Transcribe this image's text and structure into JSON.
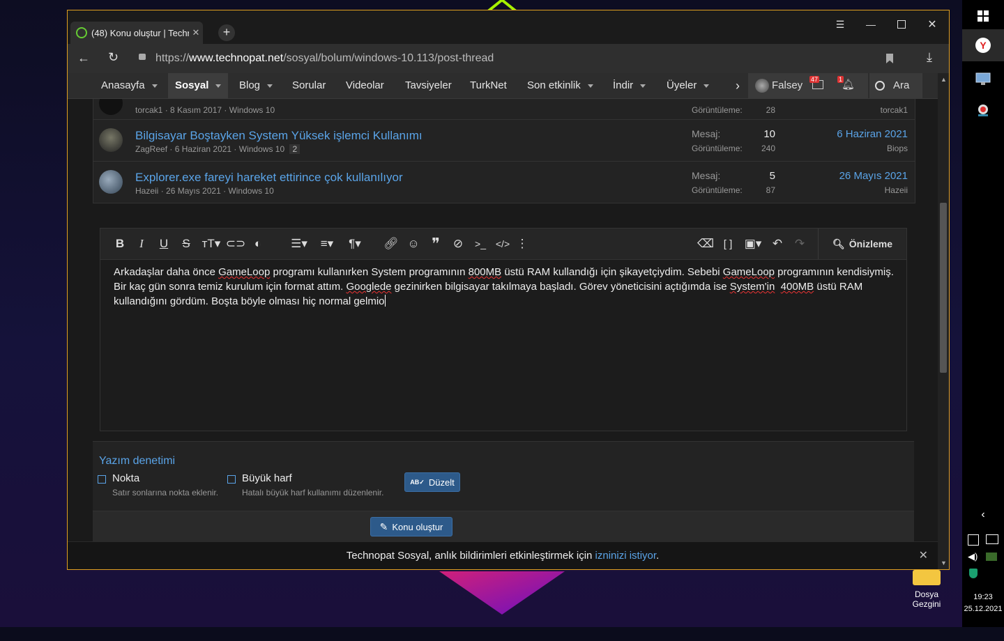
{
  "browser": {
    "tab_title": "(48) Konu oluştur | Techn",
    "url_prefix": "https://",
    "url_domain": "www.technopat.net",
    "url_path": "/sosyal/bolum/windows-10.113/post-thread"
  },
  "nav": {
    "items": [
      "Anasayfa",
      "Sosyal",
      "Blog",
      "Sorular",
      "Videolar",
      "Tavsiyeler",
      "TurkNet",
      "Son etkinlik",
      "İndir",
      "Üyeler"
    ],
    "user": "Falsey",
    "messages_badge": "47",
    "alerts_badge": "1",
    "search": "Ara"
  },
  "threads": [
    {
      "meta_user": "torcak1",
      "meta_date": "8 Kasım 2017",
      "meta_forum": "Windows 10",
      "views_label": "Görüntüleme:",
      "views": "28",
      "last_user": "torcak1"
    },
    {
      "title": "Bilgisayar Boştayken System Yüksek işlemci Kullanımı",
      "meta_user": "ZagReef",
      "meta_date": "6 Haziran 2021",
      "meta_forum": "Windows 10",
      "pages": "2",
      "msg_label": "Mesaj:",
      "messages": "10",
      "views_label": "Görüntüleme:",
      "views": "240",
      "last_date": "6 Haziran 2021",
      "last_user": "Biops"
    },
    {
      "title": "Explorer.exe fareyi hareket ettirince çok kullanılıyor",
      "meta_user": "Hazeii",
      "meta_date": "26 Mayıs 2021",
      "meta_forum": "Windows 10",
      "msg_label": "Mesaj:",
      "messages": "5",
      "views_label": "Görüntüleme:",
      "views": "87",
      "last_date": "26 Mayıs 2021",
      "last_user": "Hazeii"
    }
  ],
  "editor": {
    "preview": "Önizleme",
    "t1": "Arkadaşlar daha önce ",
    "w1": "GameLoop",
    "t2": " programı kullanırken System programının ",
    "w2": "800MB",
    "t3": " üstü RAM kullandığı için şikayetçiydim. Sebebi ",
    "w3": "GameLoop",
    "t4": " programının kendisiymiş.",
    "t5": "Bir kaç gün sonra temiz kurulum için format attım. ",
    "w4": "Googlede",
    "t6": " gezinirken bilgisayar takılmaya başladı. Görev yöneticisini açtığımda ise ",
    "w5": "System'in",
    "t7": "  ",
    "w6": "400MB",
    "t8": " üstü RAM",
    "t9": "kullandığını gördüm. Boşta böyle olması hiç normal gelmio"
  },
  "spellcheck": {
    "title": "Yazım denetimi",
    "opt1": "Nokta",
    "opt1_hint": "Satır sonlarına nokta eklenir.",
    "opt2": "Büyük harf",
    "opt2_hint": "Hatalı büyük harf kullanımı düzenlenir.",
    "fix_button": "Düzelt"
  },
  "submit_button": "Konu oluştur",
  "notification": {
    "text": "Technopat Sosyal, anlık bildirimleri etkinleştirmek için ",
    "link": "izninizi istiyor",
    "end": "."
  },
  "desktop": {
    "icon_label_1": "Dosya",
    "icon_label_2": "Gezgini",
    "time": "19:23",
    "date": "25.12.2021"
  }
}
